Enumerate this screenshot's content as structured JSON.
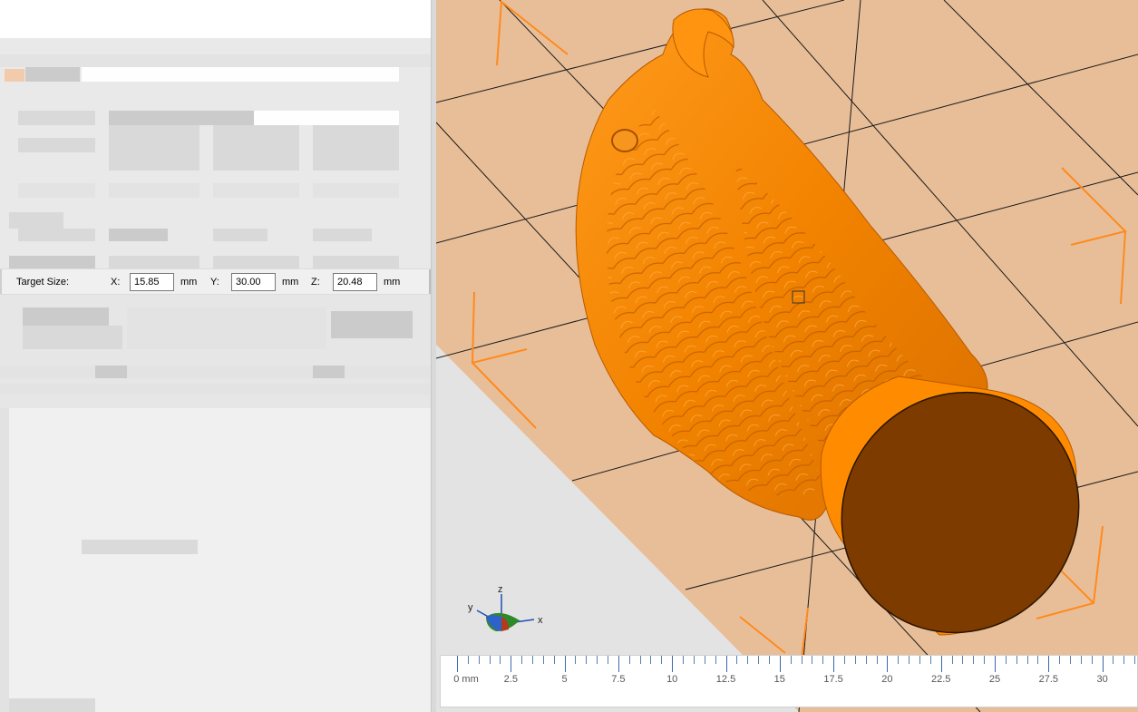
{
  "target_size": {
    "label": "Target Size:",
    "x_label": "X:",
    "x_value": "15.85",
    "y_label": "Y:",
    "y_value": "30.00",
    "z_label": "Z:",
    "z_value": "20.48",
    "unit": "mm"
  },
  "axes_gizmo": {
    "x": "x",
    "y": "y",
    "z": "z"
  },
  "ruler": {
    "labels": [
      "0 mm",
      "2.5",
      "5",
      "7.5",
      "10",
      "12.5",
      "15",
      "17.5",
      "20",
      "22.5",
      "25",
      "27.5",
      "30"
    ]
  },
  "colors": {
    "model": "#ff8c00",
    "base_face": "#7e3b00",
    "bed": "#e8be98",
    "grid": "#1a1a1a",
    "corner_marks": "#ff8a1e",
    "ruler_tick": "#3c6aa8"
  }
}
